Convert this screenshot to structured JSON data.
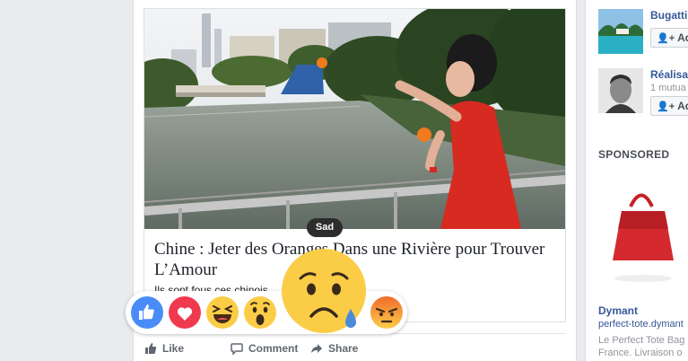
{
  "post": {
    "title": "Chine : Jeter des Oranges Dans une Rivière pour Trouver L’Amour",
    "description": "Ils sont fous ces chinois."
  },
  "actions": {
    "like_label": "Like",
    "comment_label": "Comment",
    "share_label": "Share"
  },
  "reactions": {
    "tooltip": "Sad",
    "items": [
      "like",
      "love",
      "haha",
      "wow",
      "sad",
      "angry"
    ]
  },
  "right_rail": {
    "suggestions": [
      {
        "name": "Bugatti",
        "meta": "",
        "add_label": "Add"
      },
      {
        "name": "Réalisat",
        "meta": "1 mutua",
        "add_label": "Add"
      }
    ],
    "sponsored_label": "SPONSORED",
    "ad": {
      "title": "Dymant",
      "link": "perfect-tote.dymant",
      "desc_line1": "Le Perfect Tote Bag",
      "desc_line2": "France. Livraison o"
    }
  },
  "colors": {
    "fb_blue": "#365899",
    "like_blue": "#4a8cf7",
    "love_red": "#f0384f",
    "emoji_yellow": "#fbcd47",
    "angry_orange": "#f26b2d"
  }
}
